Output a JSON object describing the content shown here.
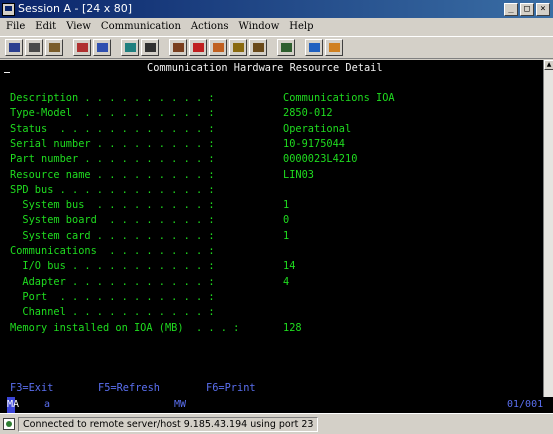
{
  "window": {
    "title": "Session A - [24 x 80]"
  },
  "menu": [
    "File",
    "Edit",
    "View",
    "Communication",
    "Actions",
    "Window",
    "Help"
  ],
  "toolbar": {
    "buttons": [
      {
        "name": "print-screen-icon",
        "color": "#2b3f8f"
      },
      {
        "name": "copy-icon",
        "color": "#4a4a4a"
      },
      {
        "name": "paste-icon",
        "color": "#7a5c2a"
      },
      {
        "name": "send-file-icon",
        "color": "#b03030"
      },
      {
        "name": "receive-file-icon",
        "color": "#3050b0"
      },
      {
        "name": "display-setup-icon",
        "color": "#1f7f7f"
      },
      {
        "name": "keyboard-map-icon",
        "color": "#303030"
      },
      {
        "name": "record-macro-icon",
        "color": "#7a3f1f"
      },
      {
        "name": "stop-macro-icon",
        "color": "#c02020"
      },
      {
        "name": "play-macro-icon",
        "color": "#c06020"
      },
      {
        "name": "macro-tape-icon",
        "color": "#8a6a10"
      },
      {
        "name": "help-macro-icon",
        "color": "#6a4a1a"
      },
      {
        "name": "clipboard-icon",
        "color": "#2f5f2f"
      },
      {
        "name": "color-map-icon",
        "color": "#2060c0"
      },
      {
        "name": "customize-icon",
        "color": "#d08020"
      }
    ]
  },
  "screen": {
    "title": "Communication Hardware Resource Detail",
    "fields": [
      {
        "label": "Description . . . . . . . . . . :",
        "value": "Communications IOA"
      },
      {
        "label": "Type-Model  . . . . . . . . . . :",
        "value": "2850-012"
      },
      {
        "label": "Status  . . . . . . . . . . . . :",
        "value": "Operational"
      },
      {
        "label": "Serial number . . . . . . . . . :",
        "value": "10-9175044"
      },
      {
        "label": "Part number . . . . . . . . . . :",
        "value": "0000023L4210"
      },
      {
        "label": "Resource name . . . . . . . . . :",
        "value": "LIN03"
      },
      {
        "label": "SPD bus . . . . . . . . . . . . :",
        "value": ""
      },
      {
        "label": "  System bus  . . . . . . . . . :",
        "value": "1"
      },
      {
        "label": "  System board  . . . . . . . . :",
        "value": "0"
      },
      {
        "label": "  System card . . . . . . . . . :",
        "value": "1"
      },
      {
        "label": "Communications  . . . . . . . . :",
        "value": ""
      },
      {
        "label": "  I/O bus . . . . . . . . . . . :",
        "value": "14"
      },
      {
        "label": "  Adapter . . . . . . . . . . . :",
        "value": "4"
      },
      {
        "label": "  Port  . . . . . . . . . . . . :",
        "value": ""
      },
      {
        "label": "  Channel . . . . . . . . . . . :",
        "value": ""
      },
      {
        "label": "Memory installed on IOA (MB)  . . . :",
        "value": "128"
      }
    ],
    "function_keys": [
      "F3=Exit",
      "F5=Refresh",
      "F6=Print"
    ]
  },
  "oia": {
    "left": "MA",
    "indicator": "a",
    "center": "MW",
    "position": "01/001"
  },
  "status": {
    "message": "Connected to remote server/host 9.185.43.194 using port 23"
  }
}
